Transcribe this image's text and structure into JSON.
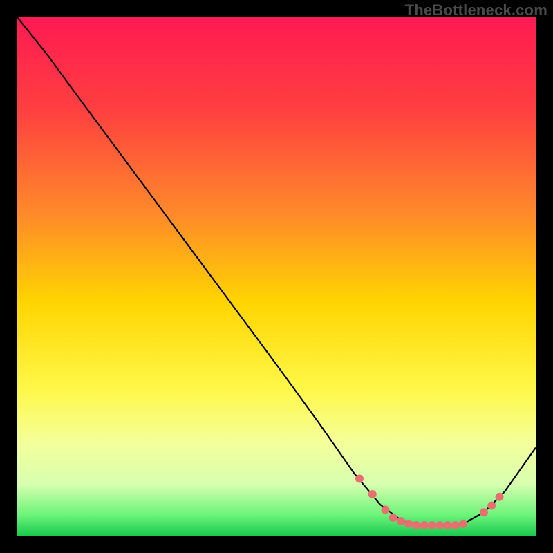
{
  "watermark": "TheBottleneck.com",
  "chart_data": {
    "type": "line",
    "title": "",
    "xlabel": "",
    "ylabel": "",
    "xlim": [
      0,
      100
    ],
    "ylim": [
      0,
      100
    ],
    "gradient_stops": [
      {
        "offset": 0,
        "color": "#ff1a52"
      },
      {
        "offset": 18,
        "color": "#ff4040"
      },
      {
        "offset": 38,
        "color": "#ff8a2a"
      },
      {
        "offset": 55,
        "color": "#ffd500"
      },
      {
        "offset": 72,
        "color": "#fff84a"
      },
      {
        "offset": 82,
        "color": "#f4ff9a"
      },
      {
        "offset": 90,
        "color": "#d8ffb0"
      },
      {
        "offset": 96,
        "color": "#6cf47a"
      },
      {
        "offset": 100,
        "color": "#19c94e"
      }
    ],
    "series": [
      {
        "name": "curve",
        "color": "#000000",
        "points": [
          {
            "x": 0.0,
            "y": 100.0
          },
          {
            "x": 6.0,
            "y": 92.5
          },
          {
            "x": 10.0,
            "y": 87.0
          },
          {
            "x": 20.0,
            "y": 73.5
          },
          {
            "x": 30.0,
            "y": 60.0
          },
          {
            "x": 40.0,
            "y": 46.5
          },
          {
            "x": 50.0,
            "y": 33.0
          },
          {
            "x": 58.0,
            "y": 22.0
          },
          {
            "x": 65.0,
            "y": 12.0
          },
          {
            "x": 70.0,
            "y": 6.0
          },
          {
            "x": 74.0,
            "y": 3.0
          },
          {
            "x": 78.0,
            "y": 2.0
          },
          {
            "x": 82.0,
            "y": 2.0
          },
          {
            "x": 86.0,
            "y": 2.3
          },
          {
            "x": 90.0,
            "y": 4.5
          },
          {
            "x": 94.0,
            "y": 8.5
          },
          {
            "x": 100.0,
            "y": 17.0
          }
        ]
      }
    ],
    "markers": {
      "name": "highlight-dots",
      "color": "#e76f6f",
      "radius": 6,
      "points": [
        {
          "x": 66.0,
          "y": 11.0
        },
        {
          "x": 68.5,
          "y": 8.0
        },
        {
          "x": 71.0,
          "y": 5.0
        },
        {
          "x": 72.5,
          "y": 3.5
        },
        {
          "x": 74.0,
          "y": 2.8
        },
        {
          "x": 75.5,
          "y": 2.3
        },
        {
          "x": 77.0,
          "y": 2.0
        },
        {
          "x": 78.5,
          "y": 2.0
        },
        {
          "x": 80.0,
          "y": 2.0
        },
        {
          "x": 81.5,
          "y": 2.0
        },
        {
          "x": 83.0,
          "y": 2.0
        },
        {
          "x": 84.5,
          "y": 2.0
        },
        {
          "x": 86.0,
          "y": 2.3
        },
        {
          "x": 90.0,
          "y": 4.5
        },
        {
          "x": 91.5,
          "y": 5.8
        },
        {
          "x": 93.0,
          "y": 7.5
        }
      ]
    }
  }
}
